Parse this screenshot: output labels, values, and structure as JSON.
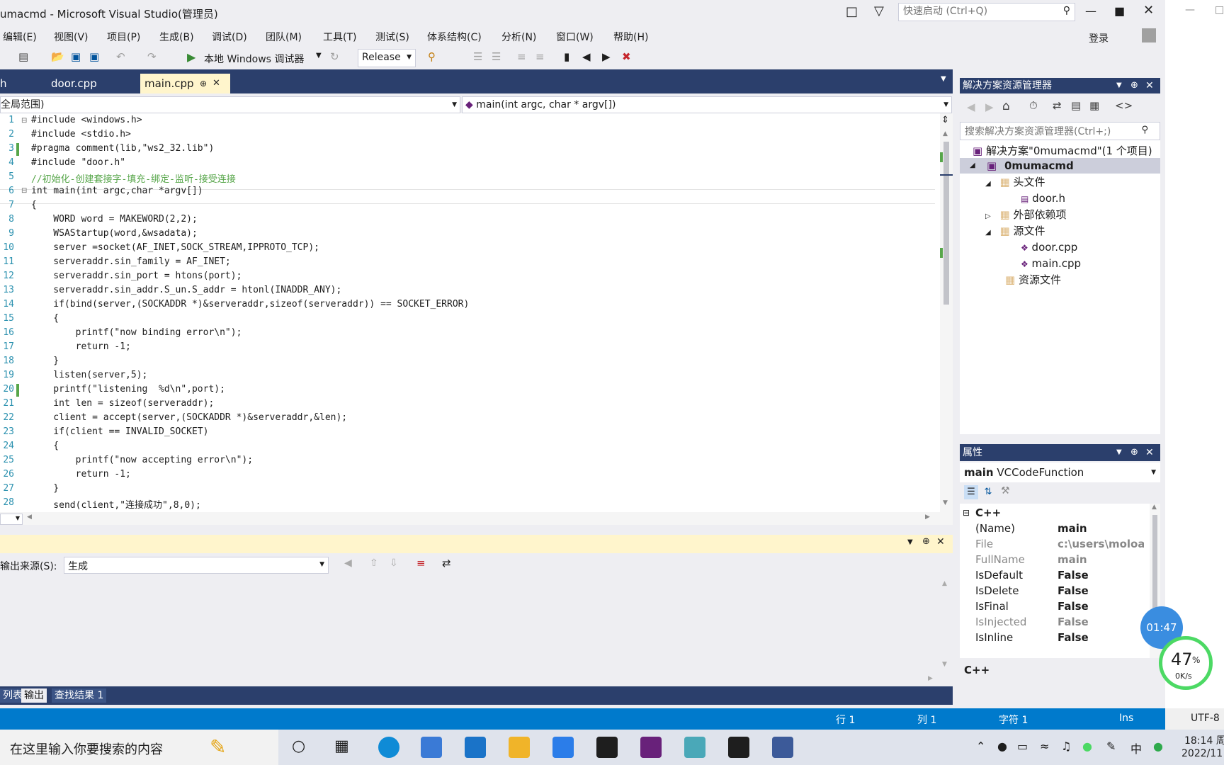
{
  "window": {
    "title": "umacmd - Microsoft Visual Studio(管理员)",
    "quick_launch_placeholder": "快速启动 (Ctrl+Q)",
    "login": "登录"
  },
  "menu": [
    "编辑(E)",
    "视图(V)",
    "项目(P)",
    "生成(B)",
    "调试(D)",
    "团队(M)",
    "工具(T)",
    "测试(S)",
    "体系结构(C)",
    "分析(N)",
    "窗口(W)",
    "帮助(H)"
  ],
  "toolbar": {
    "run_label": "本地 Windows 调试器",
    "config": "Release"
  },
  "tabs": {
    "partial": "h",
    "door": "door.cpp",
    "main": "main.cpp"
  },
  "nav": {
    "scope": "全局范围)",
    "function": "main(int argc, char * argv[])"
  },
  "code_lines": [
    {
      "n": "1",
      "t": "#include <windows.h>"
    },
    {
      "n": "2",
      "t": "#include <stdio.h>"
    },
    {
      "n": "3",
      "t": "#pragma comment(lib,\"ws2_32.lib\")"
    },
    {
      "n": "4",
      "t": "#include \"door.h\""
    },
    {
      "n": "5",
      "t": "//初始化-创建套接字-填充-绑定-监听-接受连接"
    },
    {
      "n": "6",
      "t": "int main(int argc,char *argv[])"
    },
    {
      "n": "7",
      "t": "{"
    },
    {
      "n": "8",
      "t": "    WORD word = MAKEWORD(2,2);"
    },
    {
      "n": "9",
      "t": "    WSAStartup(word,&wsadata);"
    },
    {
      "n": "10",
      "t": "    server =socket(AF_INET,SOCK_STREAM,IPPROTO_TCP);"
    },
    {
      "n": "11",
      "t": "    serveraddr.sin_family = AF_INET;"
    },
    {
      "n": "12",
      "t": "    serveraddr.sin_port = htons(port);"
    },
    {
      "n": "13",
      "t": "    serveraddr.sin_addr.S_un.S_addr = htonl(INADDR_ANY);"
    },
    {
      "n": "14",
      "t": "    if(bind(server,(SOCKADDR *)&serveraddr,sizeof(serveraddr)) == SOCKET_ERROR)"
    },
    {
      "n": "15",
      "t": "    {"
    },
    {
      "n": "16",
      "t": "        printf(\"now binding error\\n\");"
    },
    {
      "n": "17",
      "t": "        return -1;"
    },
    {
      "n": "18",
      "t": "    }"
    },
    {
      "n": "19",
      "t": "    listen(server,5);"
    },
    {
      "n": "20",
      "t": "    printf(\"listening  %d\\n\",port);"
    },
    {
      "n": "21",
      "t": "    int len = sizeof(serveraddr);"
    },
    {
      "n": "22",
      "t": "    client = accept(server,(SOCKADDR *)&serveraddr,&len);"
    },
    {
      "n": "23",
      "t": "    if(client == INVALID_SOCKET)"
    },
    {
      "n": "24",
      "t": "    {"
    },
    {
      "n": "25",
      "t": "        printf(\"now accepting error\\n\");"
    },
    {
      "n": "26",
      "t": "        return -1;"
    },
    {
      "n": "27",
      "t": "    }"
    },
    {
      "n": "28",
      "t": "    send(client,\"连接成功\",8,0);"
    }
  ],
  "output": {
    "source_label": "输出来源(S):",
    "source_value": "生成"
  },
  "bottom_tabs": [
    "列表",
    "输出",
    "查找结果 1"
  ],
  "status": {
    "line": "行 1",
    "col": "列 1",
    "char": "字符 1",
    "mode": "Ins",
    "encoding": "UTF-8"
  },
  "solution_explorer": {
    "title": "解决方案资源管理器",
    "search_placeholder": "搜索解决方案资源管理器(Ctrl+;)",
    "solution": "解决方案\"0mumacmd\"(1 个项目)",
    "project": "0mumacmd",
    "headers": "头文件",
    "door_h": "door.h",
    "external": "外部依赖项",
    "sources": "源文件",
    "door_cpp": "door.cpp",
    "main_cpp": "main.cpp",
    "resources": "资源文件"
  },
  "properties": {
    "title": "属性",
    "object_name": "main",
    "object_type": "VCCodeFunction",
    "category": "C++",
    "rows": [
      {
        "name": "(Name)",
        "value": "main"
      },
      {
        "name": "File",
        "value": "c:\\users\\moloa\\"
      },
      {
        "name": "FullName",
        "value": "main"
      },
      {
        "name": "IsDefault",
        "value": "False"
      },
      {
        "name": "IsDelete",
        "value": "False"
      },
      {
        "name": "IsFinal",
        "value": "False"
      },
      {
        "name": "IsInjected",
        "value": "False"
      },
      {
        "name": "IsInline",
        "value": "False"
      }
    ],
    "desc_title": "C++"
  },
  "overlay": {
    "timer": "01:47",
    "percent": "47",
    "percent_sign": "%",
    "speed": "0K/s"
  },
  "taskbar": {
    "search_placeholder": "在这里输入你要搜索的内容",
    "ime": "中",
    "time": "18:14 周",
    "date": "2022/11"
  },
  "colors": {
    "accent_blue": "#007acc",
    "tab_strip": "#2b3f6c",
    "keyword": "#0000ff",
    "comment": "#57a64a",
    "string": "#a31515",
    "macro": "#6f008a",
    "type": "#2b91af"
  }
}
